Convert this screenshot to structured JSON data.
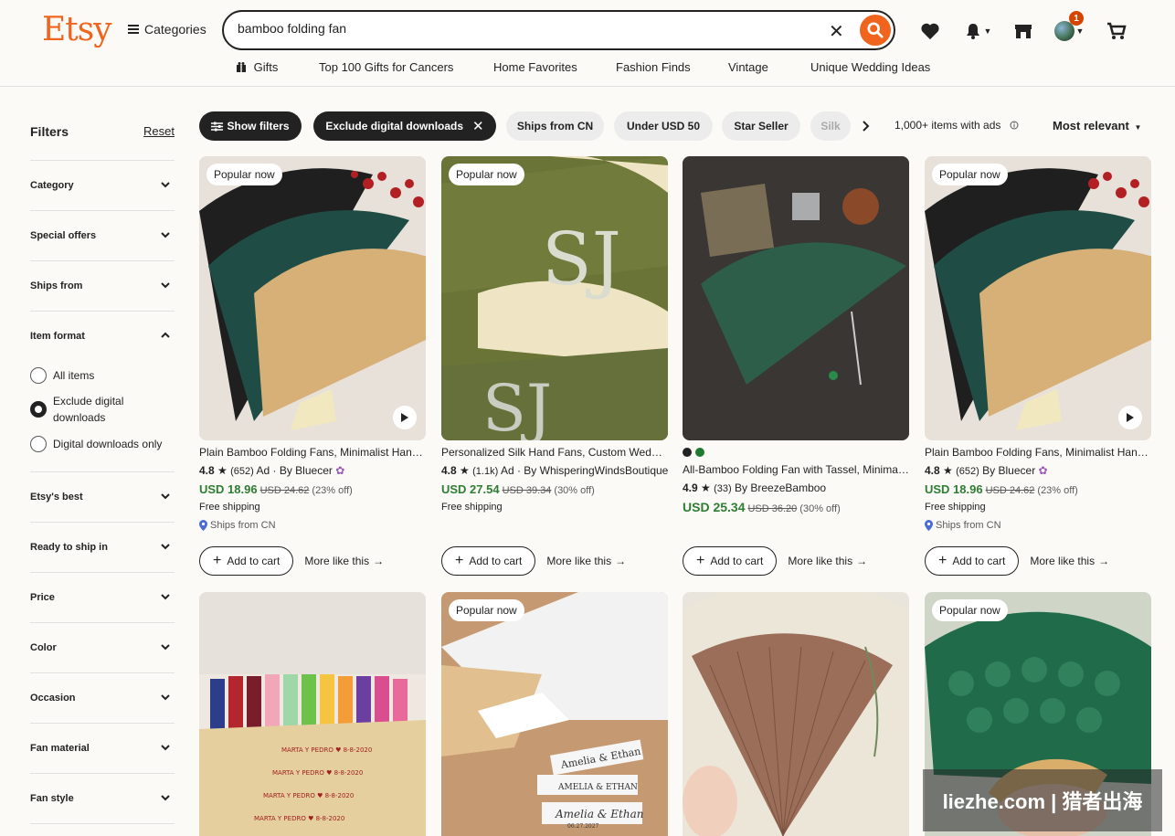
{
  "header": {
    "logo": "Etsy",
    "categories_label": "Categories",
    "search_value": "bamboo folding fan",
    "cart_badge": "1"
  },
  "nav": {
    "gifts": "Gifts",
    "top100": "Top 100 Gifts for Cancers",
    "home": "Home Favorites",
    "fashion": "Fashion Finds",
    "vintage": "Vintage",
    "wedding": "Unique Wedding Ideas"
  },
  "sidebar": {
    "title": "Filters",
    "reset": "Reset",
    "sections": {
      "category": "Category",
      "special": "Special offers",
      "shipsfrom": "Ships from",
      "itemformat": "Item format",
      "etsybest": "Etsy's best",
      "ready": "Ready to ship in",
      "price": "Price",
      "color": "Color",
      "occasion": "Occasion",
      "material": "Fan material",
      "style": "Fan style"
    },
    "format_options": {
      "all": "All items",
      "exclude": "Exclude digital downloads",
      "digital": "Digital downloads only"
    }
  },
  "chips": {
    "show_filters": "Show filters",
    "exclude_digital": "Exclude digital downloads",
    "ships_cn": "Ships from CN",
    "under50": "Under USD 50",
    "star": "Star Seller",
    "silk": "Silk"
  },
  "results": {
    "count": "1,000+ items with ads",
    "sort": "Most relevant"
  },
  "card_common": {
    "popular": "Popular now",
    "add_to_cart": "Add to cart",
    "more_like": "More like this",
    "free_shipping": "Free shipping",
    "ships_from": "Ships from CN"
  },
  "cards": [
    {
      "title": "Plain Bamboo Folding Fans, Minimalist Hand Fans",
      "rating": "4.8",
      "reviews": "(652)",
      "ad": "Ad · By Bluecer",
      "price": "USD 18.96",
      "was": "USD 24.62",
      "off": "(23% off)"
    },
    {
      "title": "Personalized Silk Hand Fans, Custom Wedding Fans",
      "rating": "4.8",
      "reviews": "(1.1k)",
      "ad": "Ad · By WhisperingWindsBoutique",
      "price": "USD 27.54",
      "was": "USD 39.34",
      "off": "(30% off)"
    },
    {
      "title": "All-Bamboo Folding Fan with Tassel, Minimalist",
      "rating": "4.9",
      "reviews": "(33)",
      "ad": "By BreezeBamboo",
      "price": "USD 25.34",
      "was": "USD 36.20",
      "off": "(30% off)"
    },
    {
      "title": "Plain Bamboo Folding Fans, Minimalist Hand Fans",
      "rating": "4.8",
      "reviews": "(652)",
      "ad": "By Bluecer",
      "price": "USD 18.96",
      "was": "USD 24.62",
      "off": "(23% off)"
    }
  ],
  "images": {
    "marta": "MARTA Y PEDRO ♥ 8-8-2020",
    "amelia": "Amelia & Ethan",
    "amelia_caps": "AMELIA & ETHAN",
    "date": "06.27.2027",
    "monogram": "SJ"
  },
  "watermark": "liezhe.com | 猎者出海",
  "colors": {
    "brand": "#f1641e",
    "price_green": "#2e7d32"
  }
}
